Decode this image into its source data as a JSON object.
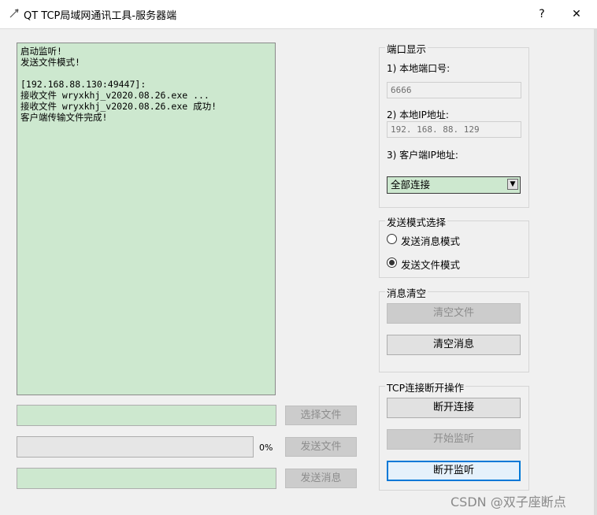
{
  "window": {
    "title": "QT TCP局域网通讯工具-服务器端",
    "help_label": "?",
    "close_label": "✕"
  },
  "log": {
    "lines": [
      "启动监听!",
      "发送文件模式!",
      "",
      "[192.168.88.130:49447]:",
      "接收文件 wryxkhj_v2020.08.26.exe ...",
      "接收文件 wryxkhj_v2020.08.26.exe 成功!",
      "客户端传输文件完成!"
    ]
  },
  "bottom": {
    "select_file_label": "选择文件",
    "progress_percent": "0%",
    "progress_value": 0,
    "send_file_label": "发送文件",
    "send_message_label": "发送消息"
  },
  "port_group": {
    "title": "端口显示",
    "local_port_label": "1) 本地端口号:",
    "local_port_value": "6666",
    "local_ip_label": "2) 本地IP地址:",
    "local_ip_value": "192. 168. 88. 129",
    "client_ip_label": "3) 客户端IP地址:",
    "client_ip_selected": "全部连接"
  },
  "mode_group": {
    "title": "发送模式选择",
    "options": [
      "发送消息模式",
      "发送文件模式"
    ],
    "selected_index": 1
  },
  "clear_group": {
    "title": "消息清空",
    "clear_file_label": "清空文件",
    "clear_message_label": "清空消息"
  },
  "tcp_group": {
    "title": "TCP连接断开操作",
    "disconnect_label": "断开连接",
    "start_listen_label": "开始监听",
    "stop_listen_label": "断开监听"
  },
  "watermark": "CSDN @双子座断点",
  "colors": {
    "accent_green": "#cde8cf",
    "focus_blue": "#0078d7"
  }
}
